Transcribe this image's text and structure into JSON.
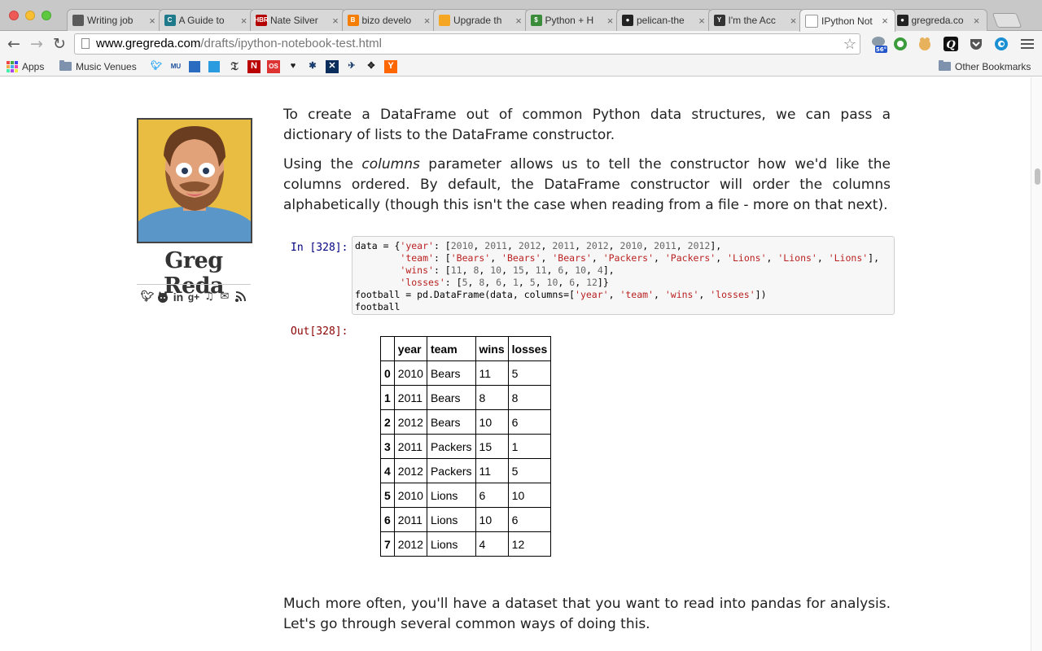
{
  "browser": {
    "tabs": [
      {
        "title": "Writing job",
        "favicon": "doc-favicon",
        "color": "#5a5a5a",
        "glyph": "",
        "active": false
      },
      {
        "title": "A Guide to",
        "favicon": "c-favicon",
        "color": "#1f7a8c",
        "glyph": "C",
        "active": false
      },
      {
        "title": "Nate Silver",
        "favicon": "hbr-favicon",
        "color": "#b30000",
        "glyph": "HBR",
        "active": false
      },
      {
        "title": "bizo develo",
        "favicon": "blogger-favicon",
        "color": "#f57d00",
        "glyph": "B",
        "active": false
      },
      {
        "title": "Upgrade th",
        "favicon": "upgrade-favicon",
        "color": "#f5a623",
        "glyph": "",
        "active": false
      },
      {
        "title": "Python + H",
        "favicon": "python-favicon",
        "color": "#3a8c3a",
        "glyph": "$",
        "active": false
      },
      {
        "title": "pelican-the",
        "favicon": "github-favicon",
        "color": "#222222",
        "glyph": "●",
        "active": false
      },
      {
        "title": "I'm the Acc",
        "favicon": "ycomb-favicon",
        "color": "#333333",
        "glyph": "Y",
        "active": false
      },
      {
        "title": "IPython Not",
        "favicon": "page-favicon",
        "color": "#ffffff",
        "glyph": "",
        "active": true
      },
      {
        "title": "gregreda.co",
        "favicon": "github-favicon",
        "color": "#222222",
        "glyph": "●",
        "active": false
      }
    ],
    "close_glyph": "×",
    "url_host": "www.gregreda.com",
    "url_path": "/drafts/ipython-notebook-test.html",
    "weather_badge": "56°",
    "bookmarks": {
      "apps_label": "Apps",
      "music_label": "Music Venues",
      "other_label": "Other Bookmarks",
      "icons": [
        "twitter-icon",
        "mu-icon",
        "amex-icon",
        "square-icon",
        "nyt-icon",
        "netflix-icon",
        "os-icon",
        "heart-icon",
        "figure-icon",
        "x-icon",
        "person-icon",
        "dots-icon",
        "ycombinator-icon"
      ]
    }
  },
  "sidebar": {
    "author": "Greg Reda",
    "social_icons": [
      "twitter-icon",
      "github-icon",
      "linkedin-icon",
      "googleplus-icon",
      "music-icon",
      "email-icon",
      "rss-icon"
    ]
  },
  "article": {
    "p1": "To create a DataFrame out of common Python data structures, we can pass a dictionary of lists to the DataFrame constructor.",
    "p2_before": "Using the ",
    "p2_em": "columns",
    "p2_after": " parameter allows us to tell the constructor how we'd like the columns ordered. By default, the DataFrame constructor will order the columns alphabetically (though this isn't the case when reading from a file - more on that next).",
    "p3": "Much more often, you'll have a dataset that you want to read into pandas for analysis. Let's go through several common ways of doing this."
  },
  "notebook": {
    "in_prompt": "In [328]:",
    "out_prompt": "Out[328]:",
    "code_lines": [
      [
        [
          "",
          "data = {"
        ],
        [
          "s",
          "'year'"
        ],
        [
          "",
          ": ["
        ],
        [
          "n",
          "2010"
        ],
        [
          "",
          ", "
        ],
        [
          "n",
          "2011"
        ],
        [
          "",
          ", "
        ],
        [
          "n",
          "2012"
        ],
        [
          "",
          ", "
        ],
        [
          "n",
          "2011"
        ],
        [
          "",
          ", "
        ],
        [
          "n",
          "2012"
        ],
        [
          "",
          ", "
        ],
        [
          "n",
          "2010"
        ],
        [
          "",
          ", "
        ],
        [
          "n",
          "2011"
        ],
        [
          "",
          ", "
        ],
        [
          "n",
          "2012"
        ],
        [
          "",
          "],"
        ]
      ],
      [
        [
          "",
          "        "
        ],
        [
          "s",
          "'team'"
        ],
        [
          "",
          ": ["
        ],
        [
          "s",
          "'Bears'"
        ],
        [
          "",
          ", "
        ],
        [
          "s",
          "'Bears'"
        ],
        [
          "",
          ", "
        ],
        [
          "s",
          "'Bears'"
        ],
        [
          "",
          ", "
        ],
        [
          "s",
          "'Packers'"
        ],
        [
          "",
          ", "
        ],
        [
          "s",
          "'Packers'"
        ],
        [
          "",
          ", "
        ],
        [
          "s",
          "'Lions'"
        ],
        [
          "",
          ", "
        ],
        [
          "s",
          "'Lions'"
        ],
        [
          "",
          ", "
        ],
        [
          "s",
          "'Lions'"
        ],
        [
          "",
          "],"
        ]
      ],
      [
        [
          "",
          "        "
        ],
        [
          "s",
          "'wins'"
        ],
        [
          "",
          ": ["
        ],
        [
          "n",
          "11"
        ],
        [
          "",
          ", "
        ],
        [
          "n",
          "8"
        ],
        [
          "",
          ", "
        ],
        [
          "n",
          "10"
        ],
        [
          "",
          ", "
        ],
        [
          "n",
          "15"
        ],
        [
          "",
          ", "
        ],
        [
          "n",
          "11"
        ],
        [
          "",
          ", "
        ],
        [
          "n",
          "6"
        ],
        [
          "",
          ", "
        ],
        [
          "n",
          "10"
        ],
        [
          "",
          ", "
        ],
        [
          "n",
          "4"
        ],
        [
          "",
          "],"
        ]
      ],
      [
        [
          "",
          "        "
        ],
        [
          "s",
          "'losses'"
        ],
        [
          "",
          ": ["
        ],
        [
          "n",
          "5"
        ],
        [
          "",
          ", "
        ],
        [
          "n",
          "8"
        ],
        [
          "",
          ", "
        ],
        [
          "n",
          "6"
        ],
        [
          "",
          ", "
        ],
        [
          "n",
          "1"
        ],
        [
          "",
          ", "
        ],
        [
          "n",
          "5"
        ],
        [
          "",
          ", "
        ],
        [
          "n",
          "10"
        ],
        [
          "",
          ", "
        ],
        [
          "n",
          "6"
        ],
        [
          "",
          ", "
        ],
        [
          "n",
          "12"
        ],
        [
          "",
          "]}"
        ]
      ],
      [
        [
          "",
          "football = pd.DataFrame(data, columns=["
        ],
        [
          "s",
          "'year'"
        ],
        [
          "",
          ", "
        ],
        [
          "s",
          "'team'"
        ],
        [
          "",
          ", "
        ],
        [
          "s",
          "'wins'"
        ],
        [
          "",
          ", "
        ],
        [
          "s",
          "'losses'"
        ],
        [
          "",
          "])"
        ]
      ],
      [
        [
          "",
          "football"
        ]
      ]
    ],
    "table": {
      "columns": [
        "",
        "year",
        "team",
        "wins",
        "losses"
      ],
      "rows": [
        [
          "0",
          "2010",
          "Bears",
          "11",
          "5"
        ],
        [
          "1",
          "2011",
          "Bears",
          "8",
          "8"
        ],
        [
          "2",
          "2012",
          "Bears",
          "10",
          "6"
        ],
        [
          "3",
          "2011",
          "Packers",
          "15",
          "1"
        ],
        [
          "4",
          "2012",
          "Packers",
          "11",
          "5"
        ],
        [
          "5",
          "2010",
          "Lions",
          "6",
          "10"
        ],
        [
          "6",
          "2011",
          "Lions",
          "10",
          "6"
        ],
        [
          "7",
          "2012",
          "Lions",
          "4",
          "12"
        ]
      ]
    }
  }
}
